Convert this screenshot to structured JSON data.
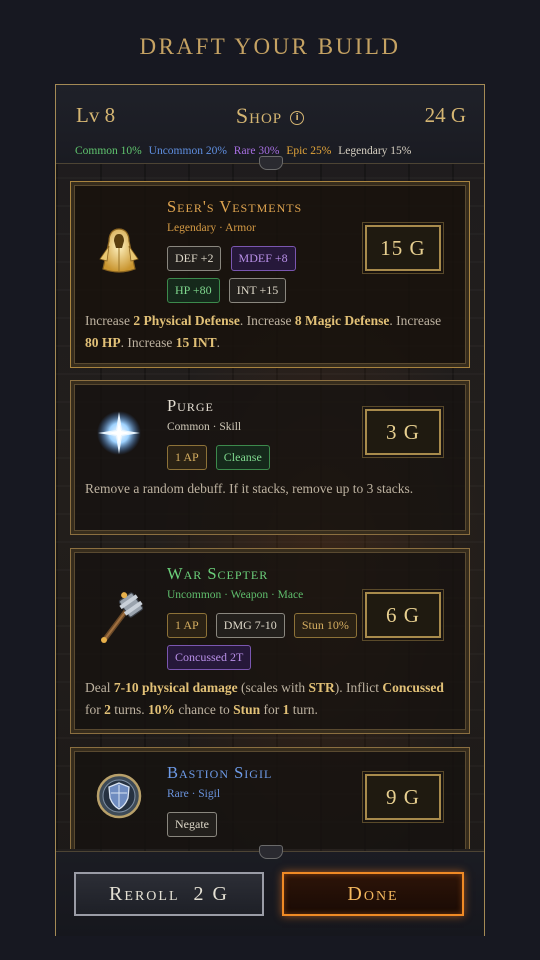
{
  "page_title": "DRAFT YOUR BUILD",
  "header": {
    "level": "Lv 8",
    "title": "Shop",
    "info_icon": "info-icon",
    "gold": "24 G",
    "rarity_odds": [
      {
        "text": "Common 10%",
        "color": "#d6d0c2"
      },
      {
        "text": "Uncommon 20%",
        "color": "#5fc46e"
      },
      {
        "text": "Rare 30%",
        "color": "#5f8fe0"
      },
      {
        "text": "Epic 25%",
        "color": "#a56ee0"
      },
      {
        "text": "Legendary 15%",
        "color": "#e3a53a"
      }
    ]
  },
  "items": [
    {
      "name": "Seer's Vestments",
      "name_color": "#e0a550",
      "subtitle": "Legendary · Armor",
      "subtitle_color": "#d49a44",
      "icon": "robe-icon",
      "price": "15 G",
      "tags": [
        {
          "text": "DEF +2",
          "style": "neutral"
        },
        {
          "text": "MDEF +8",
          "style": "epic"
        },
        {
          "text": "HP +80",
          "style": "green"
        },
        {
          "text": "INT +15",
          "style": "neutral"
        }
      ],
      "description": [
        {
          "t": "Increase ",
          "b": false
        },
        {
          "t": "2 Physical Defense",
          "b": true
        },
        {
          "t": ". Increase ",
          "b": false
        },
        {
          "t": "8 Magic Defense",
          "b": true
        },
        {
          "t": ". Increase ",
          "b": false
        },
        {
          "t": "80 HP",
          "b": true
        },
        {
          "t": ". Increase ",
          "b": false
        },
        {
          "t": "15 INT",
          "b": true
        },
        {
          "t": ".",
          "b": false
        }
      ]
    },
    {
      "name": "Purge",
      "name_color": "#e4ded2",
      "subtitle": "Common · Skill",
      "subtitle_color": "#cfc8b8",
      "icon": "light-burst-icon",
      "price": "3 G",
      "tags": [
        {
          "text": "1 AP",
          "style": "gold"
        },
        {
          "text": "Cleanse",
          "style": "green"
        }
      ],
      "description": [
        {
          "t": "Remove a random debuff. If it stacks, remove up to 3 stacks.",
          "b": false
        }
      ]
    },
    {
      "name": "War Scepter",
      "name_color": "#6bcf7a",
      "subtitle": "Uncommon · Weapon · Mace",
      "subtitle_color": "#5fbd6c",
      "icon": "mace-icon",
      "price": "6 G",
      "tags": [
        {
          "text": "1 AP",
          "style": "gold"
        },
        {
          "text": "DMG 7-10",
          "style": "neutral"
        },
        {
          "text": "Stun 10%",
          "style": "gold"
        },
        {
          "text": "Concussed 2T",
          "style": "epic"
        }
      ],
      "description": [
        {
          "t": "Deal ",
          "b": false
        },
        {
          "t": "7-10 physical damage",
          "b": true
        },
        {
          "t": " (scales with ",
          "b": false
        },
        {
          "t": "STR",
          "b": true
        },
        {
          "t": "). Inflict ",
          "b": false
        },
        {
          "t": "Concussed",
          "b": true
        },
        {
          "t": " for ",
          "b": false
        },
        {
          "t": "2",
          "b": true
        },
        {
          "t": " turns. ",
          "b": false
        },
        {
          "t": "10%",
          "b": true
        },
        {
          "t": " chance to ",
          "b": false
        },
        {
          "t": "Stun",
          "b": true
        },
        {
          "t": " for ",
          "b": false
        },
        {
          "t": "1",
          "b": true
        },
        {
          "t": " turn.",
          "b": false
        }
      ]
    },
    {
      "name": "Bastion Sigil",
      "name_color": "#6e9be8",
      "subtitle": "Rare · Sigil",
      "subtitle_color": "#6a93dc",
      "icon": "shield-sigil-icon",
      "price": "9 G",
      "tags": [
        {
          "text": "Negate",
          "style": "neutral"
        }
      ],
      "description": []
    }
  ],
  "footer": {
    "reroll_label": "Reroll",
    "reroll_cost": "2 G",
    "done_label": "Done"
  }
}
